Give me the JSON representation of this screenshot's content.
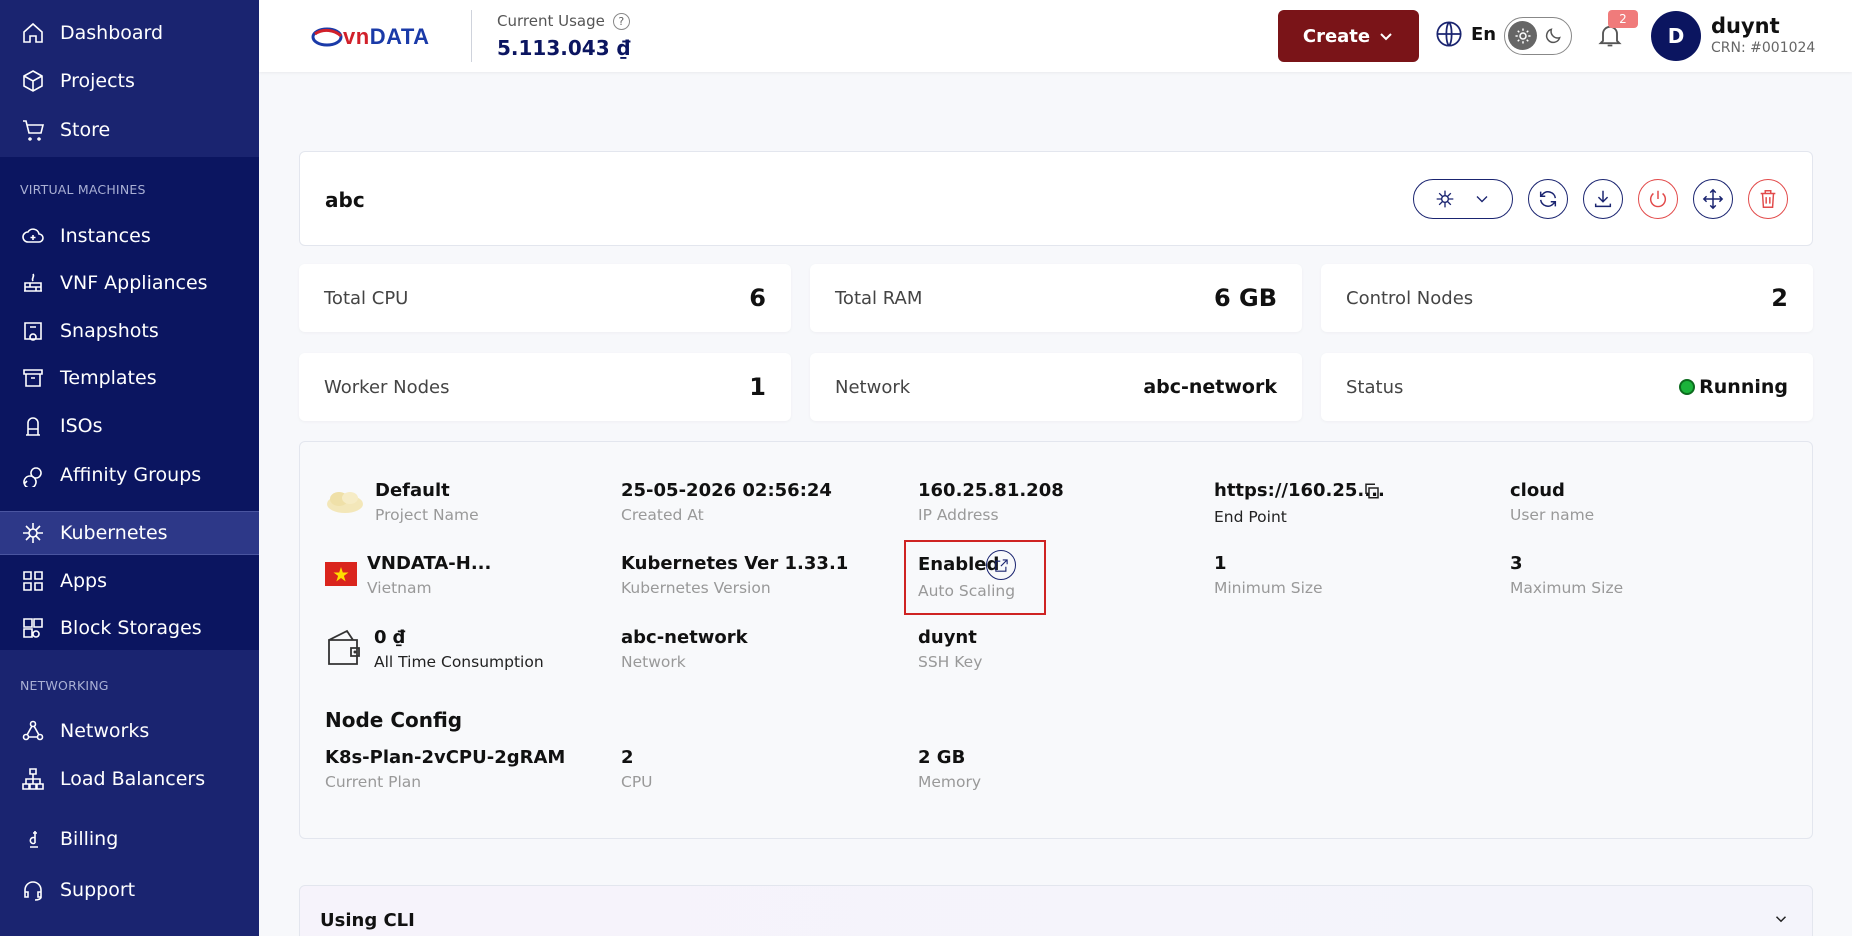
{
  "sidebar": {
    "top_items": [
      {
        "label": "Dashboard",
        "icon": "home-icon"
      },
      {
        "label": "Projects",
        "icon": "box-icon"
      },
      {
        "label": "Store",
        "icon": "cart-icon"
      }
    ],
    "vm_section_label": "VIRTUAL MACHINES",
    "vm_items": [
      {
        "label": "Instances",
        "icon": "cloud-icon"
      },
      {
        "label": "VNF Appliances",
        "icon": "firewall-icon"
      },
      {
        "label": "Snapshots",
        "icon": "camera-icon"
      },
      {
        "label": "Templates",
        "icon": "archive-icon"
      },
      {
        "label": "ISOs",
        "icon": "iso-icon"
      },
      {
        "label": "Affinity Groups",
        "icon": "affinity-icon"
      },
      {
        "label": "Kubernetes",
        "icon": "helm-icon"
      },
      {
        "label": "Apps",
        "icon": "grid-icon"
      },
      {
        "label": "Block Storages",
        "icon": "storage-icon"
      }
    ],
    "net_section_label": "NETWORKING",
    "net_items": [
      {
        "label": "Networks",
        "icon": "network-icon"
      },
      {
        "label": "Load Balancers",
        "icon": "loadbalancer-icon"
      }
    ],
    "bottom_items": [
      {
        "label": "Billing",
        "icon": "dong-icon"
      },
      {
        "label": "Support",
        "icon": "headset-icon"
      }
    ],
    "active": "Kubernetes"
  },
  "header": {
    "logo_vn": "vn",
    "logo_data": "DATA",
    "usage_label": "Current Usage",
    "usage_value": "5.113.043 ₫",
    "create_label": "Create",
    "lang": "En",
    "notifications": "2",
    "avatar_letter": "D",
    "user_name": "duynt",
    "user_crn": "CRN: #001024"
  },
  "cluster": {
    "name": "abc"
  },
  "stats": {
    "total_cpu_label": "Total CPU",
    "total_cpu": "6",
    "total_ram_label": "Total RAM",
    "total_ram": "6 GB",
    "control_nodes_label": "Control Nodes",
    "control_nodes": "2",
    "worker_nodes_label": "Worker Nodes",
    "worker_nodes": "1",
    "network_label": "Network",
    "network": "abc-network",
    "status_label": "Status",
    "status": "Running"
  },
  "details": {
    "project_name": "Default",
    "project_name_label": "Project Name",
    "created_at": "25-05-2026 02:56:24",
    "created_at_label": "Created At",
    "ip": "160.25.81.208",
    "ip_label": "IP Address",
    "endpoint": "https://160.25....",
    "endpoint_label": "End Point",
    "username": "cloud",
    "username_label": "User name",
    "zone": "VNDATA-H...",
    "zone_label": "Vietnam",
    "k8s_version": "Kubernetes Ver 1.33.1",
    "k8s_version_label": "Kubernetes Version",
    "auto_scaling": "Enabled",
    "auto_scaling_label": "Auto Scaling",
    "min_size": "1",
    "min_size_label": "Minimum Size",
    "max_size": "3",
    "max_size_label": "Maximum Size",
    "consumption": "0 ₫",
    "consumption_label": "All Time Consumption",
    "network": "abc-network",
    "network_label": "Network",
    "ssh_key": "duynt",
    "ssh_key_label": "SSH Key",
    "node_config_title": "Node Config",
    "plan": "K8s-Plan-2vCPU-2gRAM",
    "plan_label": "Current Plan",
    "cpu": "2",
    "cpu_label": "CPU",
    "memory": "2 GB",
    "memory_label": "Memory"
  },
  "cli": {
    "title": "Using CLI"
  }
}
